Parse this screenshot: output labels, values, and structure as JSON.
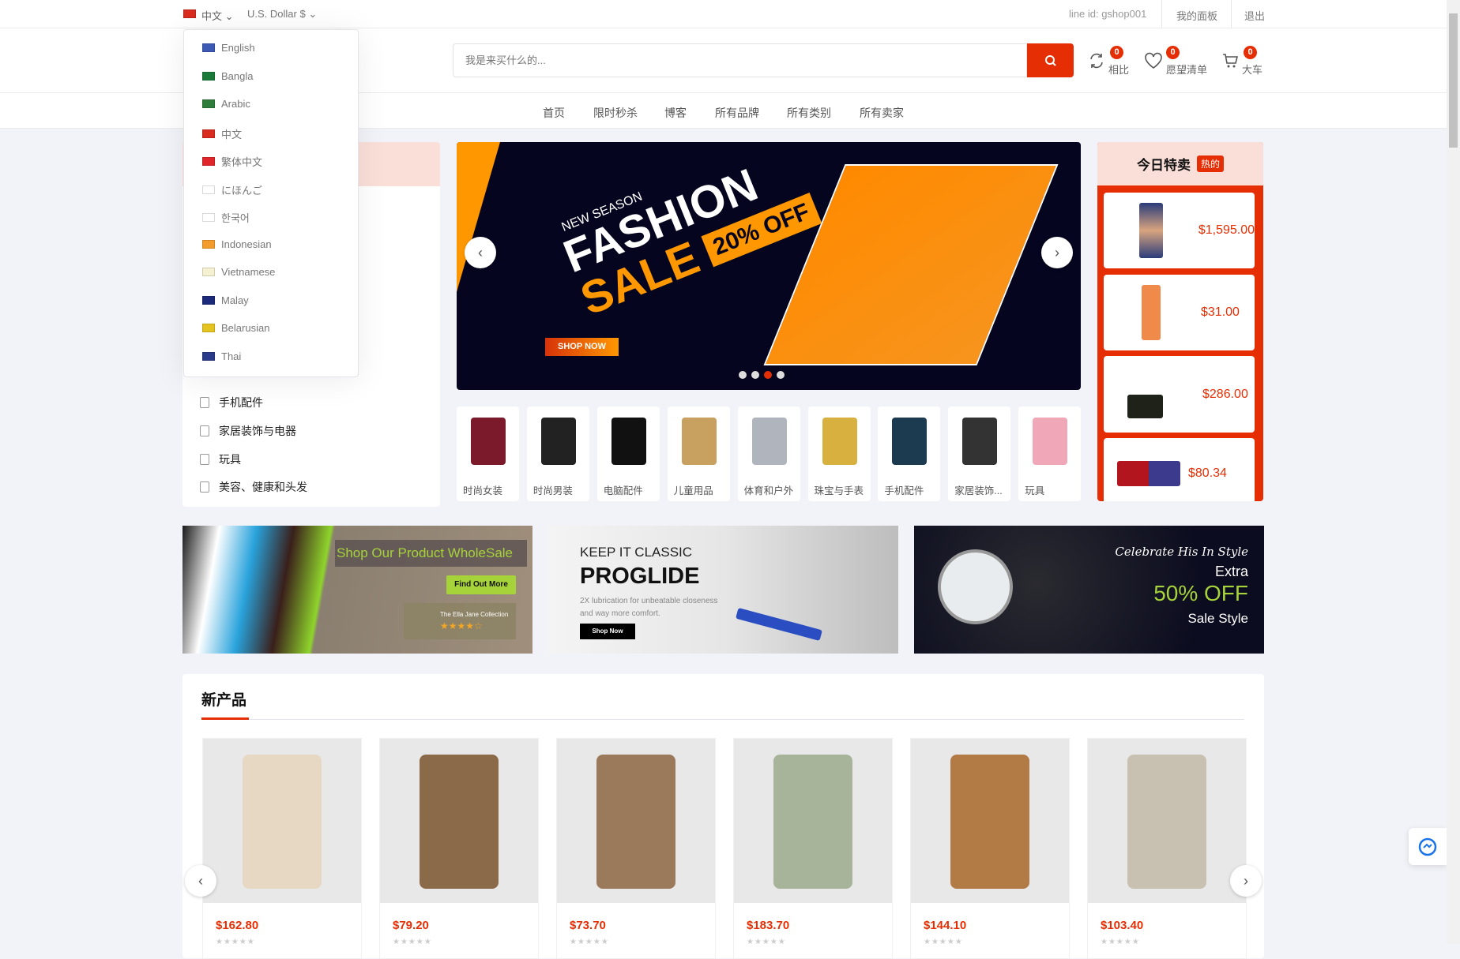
{
  "topbar": {
    "language": "中文",
    "currency": "U.S. Dollar $",
    "line_id": "line id: gshop001",
    "dashboard": "我的面板",
    "logout": "退出"
  },
  "language_menu": [
    {
      "label": "English",
      "flag": "#3c5ab4"
    },
    {
      "label": "Bangla",
      "flag": "#1a7a3a"
    },
    {
      "label": "Arabic",
      "flag": "#2f7d3a"
    },
    {
      "label": "中文",
      "flag": "#d92b1e"
    },
    {
      "label": "繁体中文",
      "flag": "#e0262b"
    },
    {
      "label": "にほんご",
      "flag": "#ffffff"
    },
    {
      "label": "한국어",
      "flag": "#ffffff"
    },
    {
      "label": "Indonesian",
      "flag": "#f39c2b"
    },
    {
      "label": "Vietnamese",
      "flag": "#f5f0d0"
    },
    {
      "label": "Malay",
      "flag": "#1d2a7a"
    },
    {
      "label": "Belarusian",
      "flag": "#e6c41f"
    },
    {
      "label": "Thai",
      "flag": "#2c3a8a"
    }
  ],
  "search": {
    "placeholder": "我是来买什么的..."
  },
  "header_icons": {
    "compare": {
      "label": "相比",
      "count": "0"
    },
    "wishlist": {
      "label": "愿望清单",
      "count": "0"
    },
    "cart": {
      "label": "大车",
      "count": "0"
    }
  },
  "nav": [
    "首页",
    "限时秒杀",
    "博客",
    "所有品牌",
    "所有类别",
    "所有卖家"
  ],
  "categories": [
    "手机配件",
    "家居装饰与电器",
    "玩具",
    "美容、健康和头发"
  ],
  "slider": {
    "kicker": "NEW SEASON",
    "title1": "FASHION",
    "title2": "SALE",
    "discount": "20% OFF",
    "cta": "SHOP NOW",
    "active_dot": 2,
    "dots": 4
  },
  "flash_deals": {
    "title": "今日特卖",
    "badge": "热的",
    "items": [
      {
        "price": "$1,595.00"
      },
      {
        "price": "$31.00"
      },
      {
        "price": "$286.00"
      },
      {
        "price": "$80.34"
      }
    ]
  },
  "category_tiles": [
    "时尚女装",
    "时尚男装",
    "电脑配件",
    "儿童用品",
    "体育和户外",
    "珠宝与手表",
    "手机配件",
    "家居装饰...",
    "玩具"
  ],
  "banners": [
    {
      "title": "Shop Our Product WholeSale",
      "cta": "Find Out More",
      "brand": "The Ella Jane Collection",
      "stars": "★★★★☆"
    },
    {
      "kicker": "KEEP IT CLASSIC",
      "title": "PROGLIDE",
      "desc1": "2X lubrication for unbeatable closeness",
      "desc2": "and way more comfort.",
      "cta": "Shop Now"
    },
    {
      "kicker": "Celebrate His In Style",
      "line1": "Extra",
      "line2": "50% OFF",
      "line3": "Sale Style"
    }
  ],
  "new_products": {
    "title": "新产品",
    "items": [
      {
        "price": "$162.80"
      },
      {
        "price": "$79.20"
      },
      {
        "price": "$73.70"
      },
      {
        "price": "$183.70"
      },
      {
        "price": "$144.10"
      },
      {
        "price": "$103.40"
      }
    ]
  },
  "colors": {
    "accent": "#e62e04",
    "pink": "#fadfd9",
    "bg": "#f2f3f8",
    "slider_bg": "#05051f",
    "orange": "#ff9800"
  }
}
